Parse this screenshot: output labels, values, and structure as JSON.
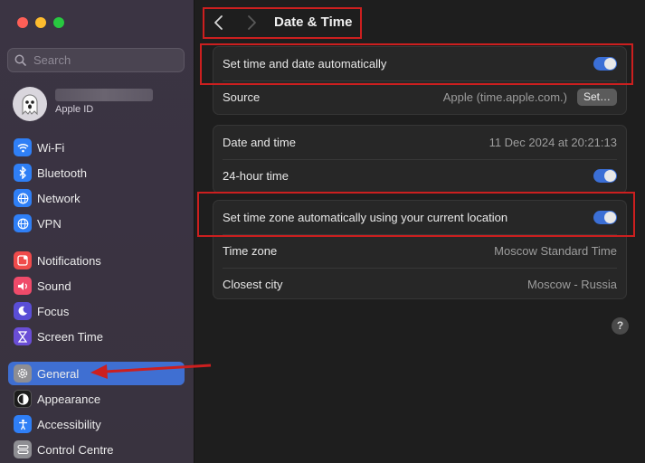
{
  "sidebar": {
    "search_placeholder": "Search",
    "apple_id_label": "Apple ID",
    "items": [
      {
        "label": "Wi-Fi",
        "icon": "wifi-icon",
        "color": "#2f7ff6"
      },
      {
        "label": "Bluetooth",
        "icon": "bluetooth-icon",
        "color": "#2f7ff6"
      },
      {
        "label": "Network",
        "icon": "globe-icon",
        "color": "#2f7ff6"
      },
      {
        "label": "VPN",
        "icon": "vpn-globe-icon",
        "color": "#2f7ff6"
      },
      {
        "label": "Notifications",
        "icon": "bell-icon",
        "color": "#ef4b4b"
      },
      {
        "label": "Sound",
        "icon": "speaker-icon",
        "color": "#ef4b6a"
      },
      {
        "label": "Focus",
        "icon": "moon-icon",
        "color": "#5a4ed6"
      },
      {
        "label": "Screen Time",
        "icon": "hourglass-icon",
        "color": "#6a4ed6"
      },
      {
        "label": "General",
        "icon": "gear-icon",
        "color": "#8e8e93"
      },
      {
        "label": "Appearance",
        "icon": "appearance-icon",
        "color": "#1c1c1c"
      },
      {
        "label": "Accessibility",
        "icon": "accessibility-icon",
        "color": "#2f7ff6"
      },
      {
        "label": "Control Centre",
        "icon": "control-centre-icon",
        "color": "#8e8e93"
      }
    ],
    "selected": "General"
  },
  "header": {
    "title": "Date & Time"
  },
  "group1": {
    "auto_label": "Set time and date automatically",
    "auto_on": true,
    "source_label": "Source",
    "source_value": "Apple (time.apple.com.)",
    "set_button": "Set…"
  },
  "group2": {
    "datetime_label": "Date and time",
    "datetime_value": "11 Dec 2024 at 20:21:13",
    "hour24_label": "24-hour time",
    "hour24_on": true
  },
  "group3": {
    "tz_auto_label": "Set time zone automatically using your current location",
    "tz_auto_on": true,
    "tz_label": "Time zone",
    "tz_value": "Moscow Standard Time",
    "city_label": "Closest city",
    "city_value": "Moscow - Russia"
  },
  "help": "?",
  "accent_color": "#3b6fd6",
  "annotation_color": "#cc1f1f"
}
